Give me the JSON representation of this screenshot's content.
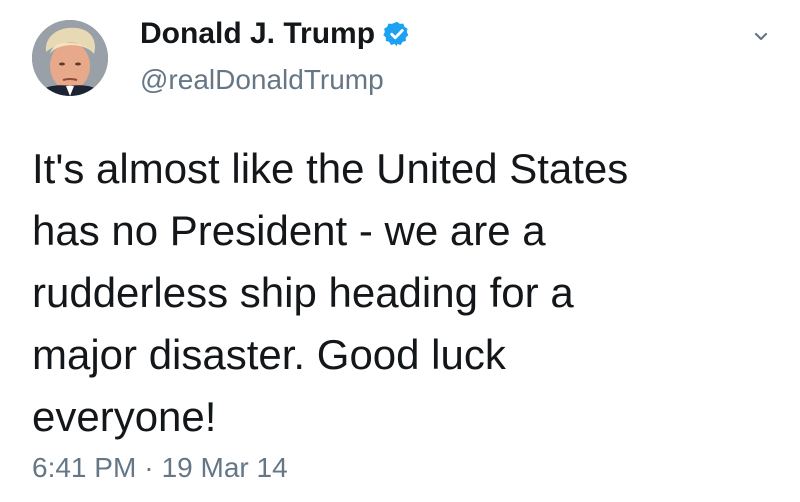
{
  "author": {
    "display_name": "Donald J. Trump",
    "handle": "@realDonaldTrump",
    "verified": true,
    "avatar_icon": "profile-photo"
  },
  "tweet": {
    "text_lines": [
      "It's almost like the United States",
      "has no President - we are a",
      "rudderless ship heading for a",
      "major disaster. Good luck",
      "everyone!"
    ],
    "time": "6:41 PM",
    "separator": "·",
    "date": "19 Mar 14"
  },
  "icons": {
    "verified": "verified-badge-icon",
    "menu": "chevron-down-icon"
  },
  "colors": {
    "verified_blue": "#1da1f2",
    "secondary_text": "#657786",
    "primary_text": "#14171a"
  }
}
